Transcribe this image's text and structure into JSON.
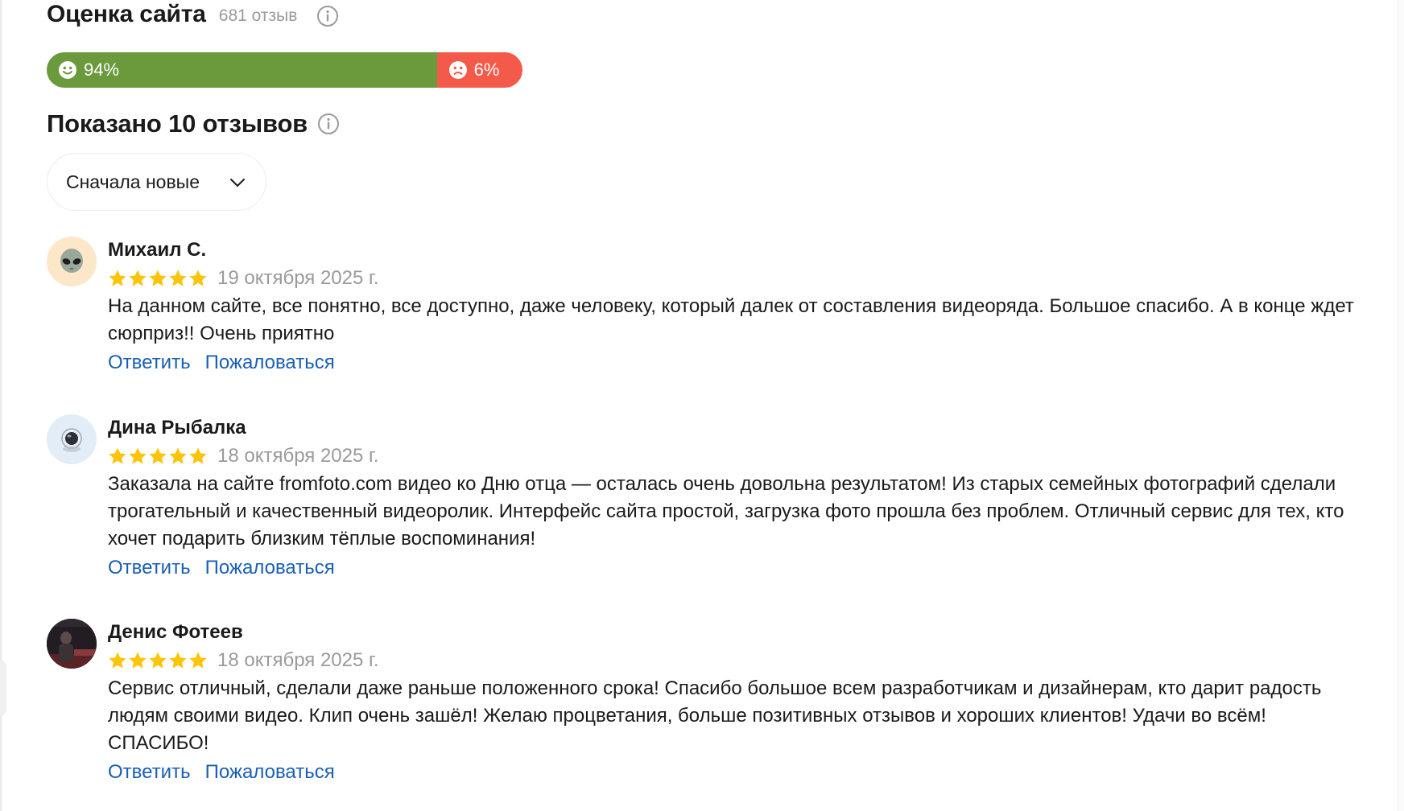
{
  "rating": {
    "title": "Оценка сайта",
    "count": "681 отзыв",
    "info_icon": "info-icon"
  },
  "sentiment": {
    "positive_label": "94%",
    "negative_label": "6%",
    "positive_fraction": 0.82,
    "positive_color": "#6a9a3c",
    "negative_color": "#f35a4a",
    "positive_icon": "smile-icon",
    "negative_icon": "sad-icon"
  },
  "shown": {
    "title": "Показано 10 отзывов",
    "info_icon": "info-icon"
  },
  "sort": {
    "selected": "Сначала новые",
    "icon": "chevron-down-icon"
  },
  "actions": {
    "reply": "Ответить",
    "report": "Пожаловаться"
  },
  "reviews": [
    {
      "author": "Михаил С.",
      "stars": 5,
      "date": "19 октября 2025 г.",
      "text": "На данном сайте, все понятно, все доступно, даже человеку, который далек от составления видеоряда. Большое спасибо. А в конце ждет сюрприз!! Очень приятно",
      "avatar_icon": "alien-avatar-icon"
    },
    {
      "author": "Дина Рыбалка",
      "stars": 5,
      "date": "18 октября 2025 г.",
      "text": "Заказала на сайте fromfoto.com видео ко Дню отца — осталась очень довольна результатом! Из старых семейных фотографий сделали трогательный и качественный видеоролик. Интерфейс сайта простой, загрузка фото прошла без проблем. Отличный сервис для тех, кто хочет подарить близким тёплые воспоминания!",
      "avatar_icon": "astronaut-avatar-icon"
    },
    {
      "author": "Денис Фотеев",
      "stars": 5,
      "date": "18 октября 2025 г.",
      "text": "Сервис отличный, сделали даже раньше положенного срока! Спасибо большое всем разработчикам и дизайнерам, кто дарит радость людям своими видео. Клип очень зашёл! Желаю процветания, больше позитивных отзывов и хороших клиентов!  Удачи во всём! СПАСИБО!",
      "avatar_icon": "photo-avatar-icon"
    }
  ],
  "colors": {
    "link": "#1a5fb4",
    "star": "#fcc40a",
    "muted": "#9a9a9a"
  }
}
